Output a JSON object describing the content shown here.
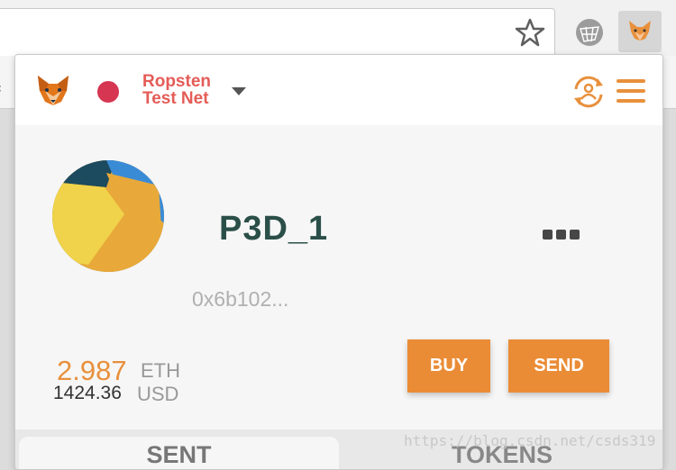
{
  "network": {
    "name_line1": "Ropsten",
    "name_line2": "Test Net"
  },
  "account": {
    "name": "P3D_1",
    "address": "0x6b102...",
    "balance_eth": "2.987",
    "eth_unit": "ETH",
    "balance_usd": "1424.36",
    "usd_unit": "USD"
  },
  "actions": {
    "buy": "BUY",
    "send": "SEND"
  },
  "tabs": [
    "SENT",
    "TOKENS"
  ],
  "watermark": "https://blog.csdn.net/csds319",
  "colors": {
    "accent": "#e8903c",
    "network": "#d63652",
    "account_name": "#2a4f48"
  },
  "icons": [
    "star-icon",
    "webstore-icon",
    "metamask-fox-icon",
    "account-switch-icon",
    "hamburger-menu-icon",
    "more-dots-icon"
  ]
}
